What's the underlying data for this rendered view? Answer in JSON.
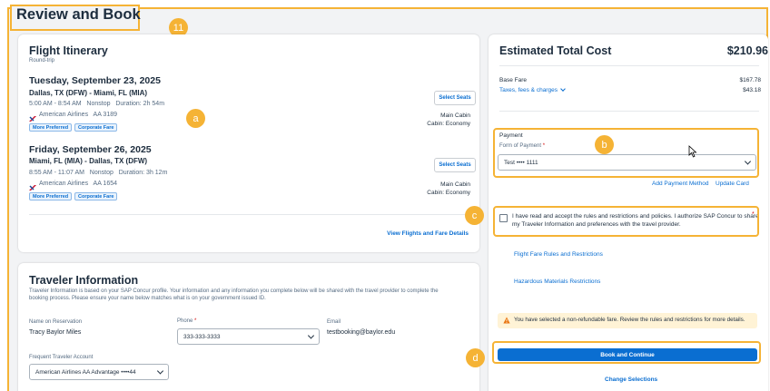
{
  "page": {
    "title": "Review and Book"
  },
  "markers": {
    "m11": "11",
    "a": "a",
    "b": "b",
    "c": "c",
    "d": "d"
  },
  "itinerary": {
    "title": "Flight Itinerary",
    "trip_type": "Round-trip",
    "flights": [
      {
        "date": "Tuesday, September 23, 2025",
        "route": "Dallas, TX (DFW) - Miami, FL (MIA)",
        "times": "5:00 AM - 8:54 AM   Nonstop   Duration: 2h 54m",
        "carrier": "American Airlines   AA 3189",
        "tags": [
          "More Preferred",
          "Corporate Fare"
        ],
        "seat_button": "Select Seats",
        "cabin": "Main Cabin",
        "cabin_class": "Cabin: Economy"
      },
      {
        "date": "Friday, September 26, 2025",
        "route": "Miami, FL (MIA) - Dallas, TX (DFW)",
        "times": "8:55 AM - 11:07 AM   Nonstop   Duration: 3h 12m",
        "carrier": "American Airlines   AA 1654",
        "tags": [
          "More Preferred",
          "Corporate Fare"
        ],
        "seat_button": "Select Seats",
        "cabin": "Main Cabin",
        "cabin_class": "Cabin: Economy"
      }
    ],
    "details_link": "View Flights and Fare Details"
  },
  "traveler": {
    "title": "Traveler Information",
    "description_line1": "Traveler Information is based on your SAP Concur profile. Your information and any information you complete below will be shared with the travel provider to complete the",
    "description_line2": "booking process. Please ensure your name below matches what is on your government issued ID.",
    "name_label": "Name on Reservation",
    "name_value": "Tracy Baylor Miles",
    "phone_label": "Phone",
    "phone_value": "333-333-3333",
    "email_label": "Email",
    "email_value": "testbooking@baylor.edu",
    "ffa_label": "Frequent Traveler Account",
    "ffa_value": "American Airlines AA Advantage ••••44"
  },
  "cost": {
    "title": "Estimated Total Cost",
    "total": "$210.96",
    "base_fare_label": "Base Fare",
    "base_fare": "$167.78",
    "taxes_label": "Taxes, fees & charges",
    "taxes": "$43.18"
  },
  "payment": {
    "section_label": "Payment",
    "form_label": "Form of Payment",
    "form_value": "Test •••• 1111",
    "add_method": "Add Payment Method",
    "update_card": "Update Card"
  },
  "agreement": {
    "text_line1": "I have read and accept the rules and restrictions and policies. I authorize SAP Concur to share",
    "text_line2": "my Traveler Information and preferences with the travel provider."
  },
  "rules_links": {
    "fare_rules": "Flight Fare Rules and Restrictions",
    "hazardous": "Hazardous Materials Restrictions"
  },
  "warning": {
    "text": "You have selected a non-refundable fare. Review the rules and restrictions for more details."
  },
  "actions": {
    "book": "Book and Continue",
    "change": "Change Selections"
  },
  "colors": {
    "accent": "#0a6ed1",
    "highlight": "#f5b335",
    "warning_bg": "#fff3d6"
  }
}
